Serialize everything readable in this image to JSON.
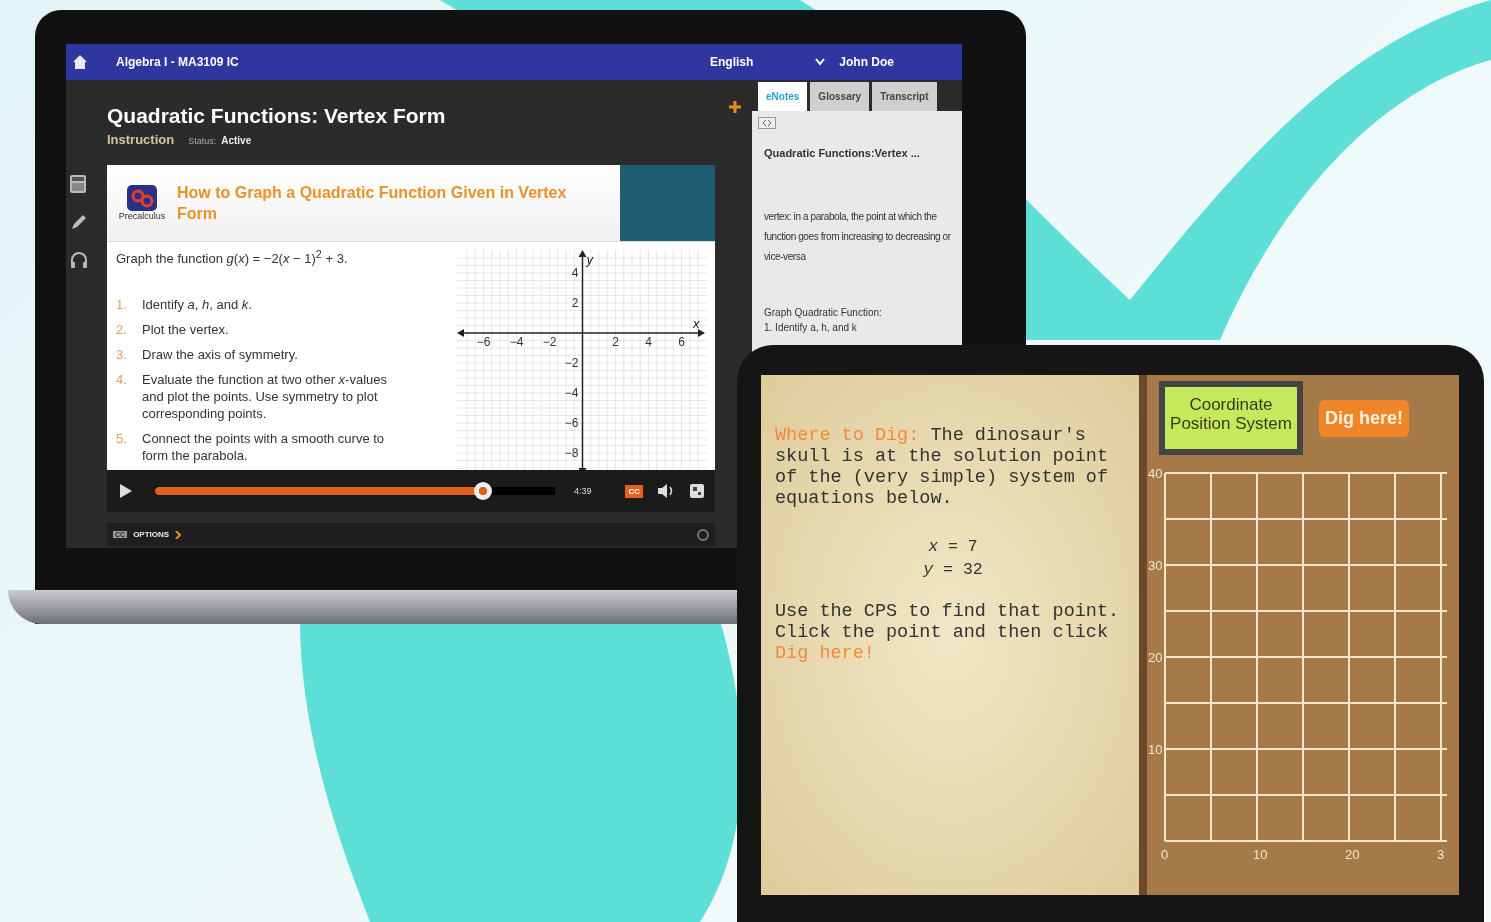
{
  "laptop": {
    "header": {
      "course": "Algebra I - MA3109 IC",
      "language": "English",
      "user": "John Doe"
    },
    "lesson": {
      "title": "Quadratic Functions: Vertex Form",
      "type": "Instruction",
      "status_label": "Status:",
      "status": "Active"
    },
    "card": {
      "heading": "How to Graph a Quadratic Function Given in Vertex Form",
      "logo_caption": "Precalculus",
      "prompt": "Graph the function *g*(*x*) = −2(*x* − 1)$^{2}$ + 3.",
      "steps": [
        {
          "number": "1.",
          "text": "Identify *a*, *h*, and *k*."
        },
        {
          "number": "2.",
          "text": "Plot the vertex."
        },
        {
          "number": "3.",
          "text": "Draw the axis of symmetry."
        },
        {
          "number": "4.",
          "text": "Evaluate the function at two other *x*-values and plot the points. Use symmetry to plot corresponding points."
        },
        {
          "number": "5.",
          "text": "Connect the points with a smooth curve to form the parabola."
        }
      ],
      "graph": {
        "x_label": "x",
        "y_label": "y",
        "x_ticks": [
          "−6",
          "−4",
          "−2",
          "2",
          "4",
          "6"
        ],
        "y_ticks": [
          "4",
          "2",
          "−2",
          "−4",
          "−6",
          "−8"
        ]
      }
    },
    "player": {
      "level": 0.82,
      "time": "4:39",
      "captions_label": "CC",
      "options_label": "OPTIONS",
      "options_cc": "CC"
    },
    "notes": {
      "tabs": [
        {
          "label": "eNotes",
          "selected": true
        },
        {
          "label": "Glossary",
          "selected": false
        },
        {
          "label": "Transcript",
          "selected": false
        }
      ],
      "heading": "Quadratic Functions:Vertex ...",
      "definition": "vertex: in a parabola, the point at which the function goes from increasing to decreasing or vice-versa",
      "section": "Graph Quadratic Function:",
      "item": "1. Identify a, h, and k"
    }
  },
  "tablet": {
    "paragraphs": [
      [
        {
          "text": "Where to Dig:",
          "highlight": true
        },
        {
          "text": " The dinosaur's skull is at the solution point of the (very simple) system of equations below.",
          "highlight": false
        }
      ],
      [
        {
          "text": "Use the CPS to find that point. Click the point and then click ",
          "highlight": false
        },
        {
          "text": "Dig here!",
          "highlight": true
        }
      ]
    ],
    "equations": [
      "*x* = 7",
      "*y* = 32"
    ],
    "cps_label": "Coordinate Position System",
    "dig_button": "Dig here!",
    "grid": {
      "y_ticks": [
        "40",
        "30",
        "20",
        "10"
      ],
      "x_ticks": [
        "0",
        "10",
        "20",
        "3"
      ]
    }
  }
}
